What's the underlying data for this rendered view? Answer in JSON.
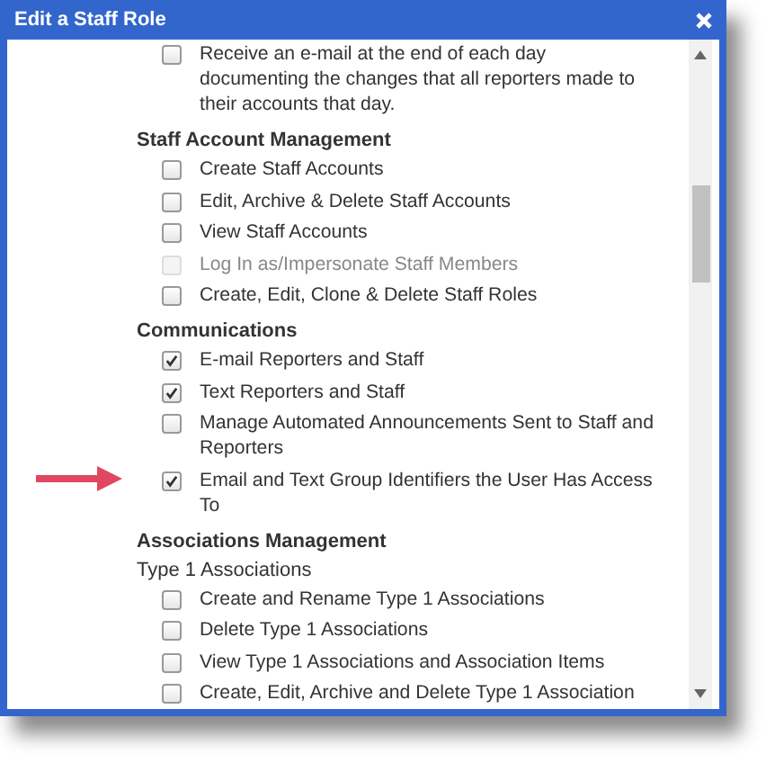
{
  "dialog": {
    "title": "Edit a Staff Role"
  },
  "sections": [
    {
      "items": [
        {
          "kind": "checkbox",
          "label": "Receive an e-mail at the end of each day documenting the changes that all reporters made to their accounts that day.",
          "checked": false,
          "disabled": false
        }
      ]
    },
    {
      "heading": "Staff Account Management",
      "items": [
        {
          "kind": "checkbox",
          "label": "Create Staff Accounts",
          "checked": false,
          "disabled": false
        },
        {
          "kind": "checkbox",
          "label": "Edit, Archive & Delete Staff Accounts",
          "checked": false,
          "disabled": false
        },
        {
          "kind": "checkbox",
          "label": "View Staff Accounts",
          "checked": false,
          "disabled": false
        },
        {
          "kind": "checkbox",
          "label": "Log In as/Impersonate Staff Members",
          "checked": false,
          "disabled": true
        },
        {
          "kind": "checkbox",
          "label": "Create, Edit, Clone & Delete Staff Roles",
          "checked": false,
          "disabled": false
        }
      ]
    },
    {
      "heading": "Communications",
      "items": [
        {
          "kind": "checkbox",
          "label": "E-mail Reporters and Staff",
          "checked": true,
          "disabled": false
        },
        {
          "kind": "checkbox",
          "label": "Text Reporters and Staff",
          "checked": true,
          "disabled": false
        },
        {
          "kind": "checkbox",
          "label": "Manage Automated Announcements Sent to Staff and Reporters",
          "checked": false,
          "disabled": false
        },
        {
          "kind": "checkbox",
          "label": "Email and Text Group Identifiers the User Has Access To",
          "checked": true,
          "disabled": false,
          "annotated": true
        }
      ]
    },
    {
      "heading": "Associations Management",
      "items": [
        {
          "kind": "subheading",
          "label": "Type 1 Associations"
        },
        {
          "kind": "checkbox",
          "label": "Create and Rename Type 1 Associations",
          "checked": false,
          "disabled": false
        },
        {
          "kind": "checkbox",
          "label": "Delete Type 1 Associations",
          "checked": false,
          "disabled": false
        },
        {
          "kind": "checkbox",
          "label": "View Type 1 Associations and Association Items",
          "checked": false,
          "disabled": false
        },
        {
          "kind": "checkbox",
          "label": "Create, Edit, Archive and Delete Type 1 Association",
          "checked": false,
          "disabled": false
        }
      ]
    }
  ]
}
